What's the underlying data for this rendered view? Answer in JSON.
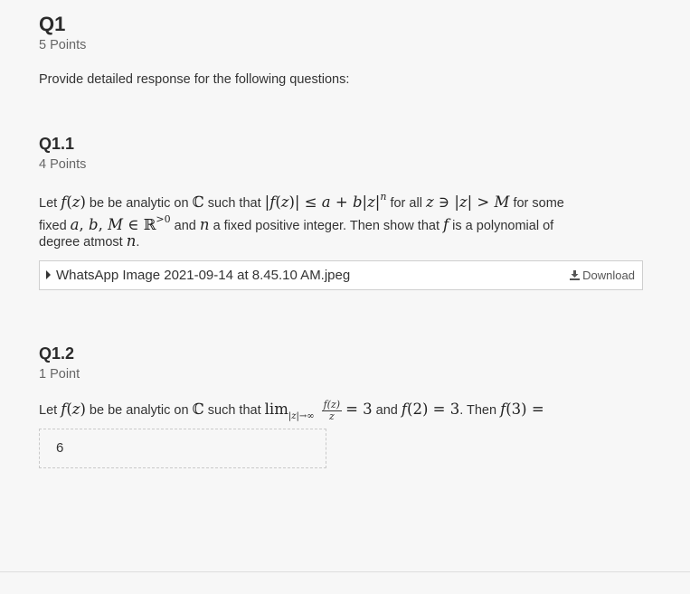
{
  "q1": {
    "title": "Q1",
    "points": "5 Points",
    "intro": "Provide detailed response for the following questions:"
  },
  "q1_1": {
    "title": "Q1.1",
    "points": "4 Points",
    "text": {
      "let": "Let",
      "be_analytic_on": "be be analytic on",
      "such_that": "such that",
      "for_all": "for all",
      "for_some": "for some",
      "fixed": "fixed",
      "and": "and",
      "fixed_pos_int": "a fixed positive integer. Then show that",
      "is_poly": "is a polynomial of",
      "degree_atmost": "degree atmost",
      "period": "."
    },
    "attachment": {
      "filename": "WhatsApp Image 2021-09-14 at 8.45.10 AM.jpeg",
      "download_label": "Download"
    }
  },
  "q1_2": {
    "title": "Q1.2",
    "points": "1 Point",
    "text": {
      "let": "Let",
      "be_analytic_on": "be be analytic on",
      "such_that": "such that",
      "and": "and",
      "then": ". Then"
    },
    "answer_value": "6"
  }
}
